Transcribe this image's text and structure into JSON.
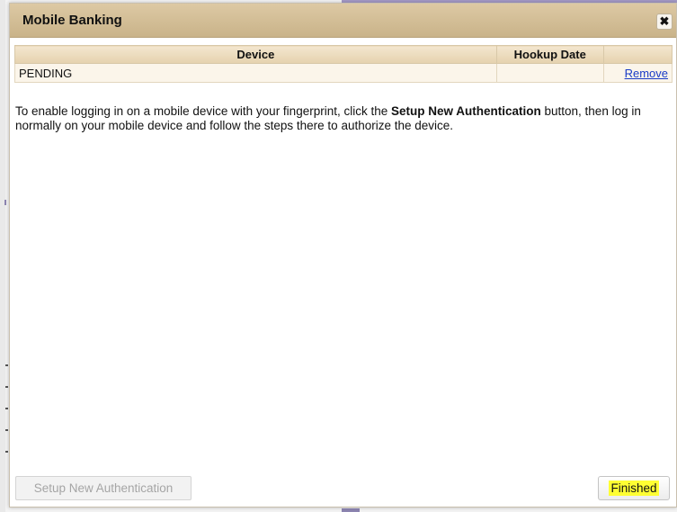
{
  "dialog": {
    "title": "Mobile Banking",
    "close_icon": "close-icon",
    "close_glyph": "✖"
  },
  "table": {
    "headers": [
      "Device",
      "Hookup Date",
      ""
    ],
    "rows": [
      {
        "device": "PENDING",
        "hookup_date": "",
        "action": "Remove"
      }
    ]
  },
  "instructions": {
    "before": "To enable logging in on a mobile device with your fingerprint, click the ",
    "bold": "Setup New Authentication",
    "after": " button, then log in normally on your mobile device and follow the steps there to authorize the device."
  },
  "footer": {
    "setup_label": "Setup New Authentication",
    "finished_label": "Finished"
  },
  "colors": {
    "titlebar": "#d4bf98",
    "link": "#1a3cc7",
    "highlight": "#ffff33"
  }
}
